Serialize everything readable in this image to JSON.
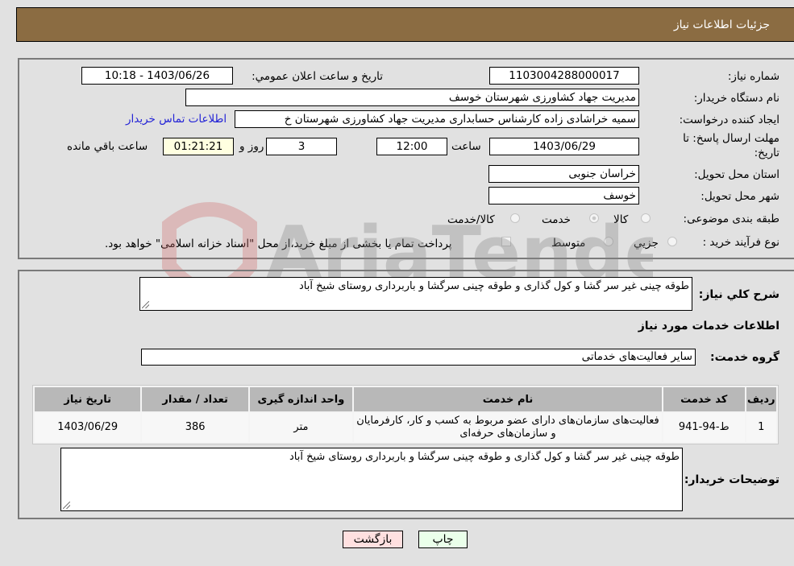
{
  "header": {
    "title": "جزئیات اطلاعات نیاز"
  },
  "form": {
    "need_number_label": "شماره نیاز:",
    "need_number": "1103004288000017",
    "announce_label": "تاریخ و ساعت اعلان عمومي:",
    "announce_value": "1403/06/26 - 10:18",
    "buyer_org_label": "نام دستگاه خریدار:",
    "buyer_org": "مدیریت جهاد کشاورزی شهرستان خوسف",
    "creator_label": "ایجاد کننده درخواست:",
    "creator": "سمیه خراشادی زاده کارشناس حسابداری مدیریت جهاد کشاورزی شهرستان خ",
    "contact_link": "اطلاعات تماس خریدار",
    "deadline_label": "مهلت ارسال پاسخ: تا تاریخ:",
    "deadline_date": "1403/06/29",
    "time_label": "ساعت",
    "deadline_time": "12:00",
    "days_value": "3",
    "days_label": "روز و",
    "remaining_time": "01:21:21",
    "remaining_label": "ساعت باقي مانده",
    "province_label": "استان محل تحویل:",
    "province": "خراسان جنوبی",
    "city_label": "شهر محل تحویل:",
    "city": "خوسف",
    "category_label": "طبقه بندی موضوعی:",
    "category_options": [
      "کالا",
      "خدمت",
      "کالا/خدمت"
    ],
    "category_selected": "خدمت",
    "process_label": "نوع فرآیند خرید :",
    "process_options": [
      "جزيي",
      "متوسط"
    ],
    "treasury_note": "پرداخت تمام یا بخشی از مبلغ خرید،از محل \"اسناد خزانه اسلامی\" خواهد بود."
  },
  "details": {
    "description_label": "شرح کلي نياز:",
    "description": "طوقه چینی غیر سر گشا و کول گذاری و طوقه چینی سرگشا و باربرداری روستای شیخ آباد",
    "services_heading": "اطلاعات خدمات مورد نیاز",
    "service_group_label": "گروه خدمت:",
    "service_group": "سایر فعالیت‌های خدماتی",
    "table": {
      "headers": [
        "ردیف",
        "کد خدمت",
        "نام خدمت",
        "واحد اندازه گیری",
        "تعداد / مقدار",
        "تاریخ نیاز"
      ],
      "rows": [
        [
          "1",
          "ط-94-941",
          "فعالیت‌های سازمان‌های دارای عضو مربوط به کسب و کار، کارفرمایان و سازمان‌های حرفه‌ای",
          "متر",
          "386",
          "1403/06/29"
        ]
      ]
    },
    "buyer_notes_label": "توضیحات خریدار:",
    "buyer_notes": "طوقه چینی غیر سر گشا و کول گذاری و طوقه چینی سرگشا و باربرداری روستای شیخ آباد"
  },
  "buttons": {
    "print": "چاپ",
    "back": "بازگشت"
  },
  "watermark": "AriaTender.net"
}
